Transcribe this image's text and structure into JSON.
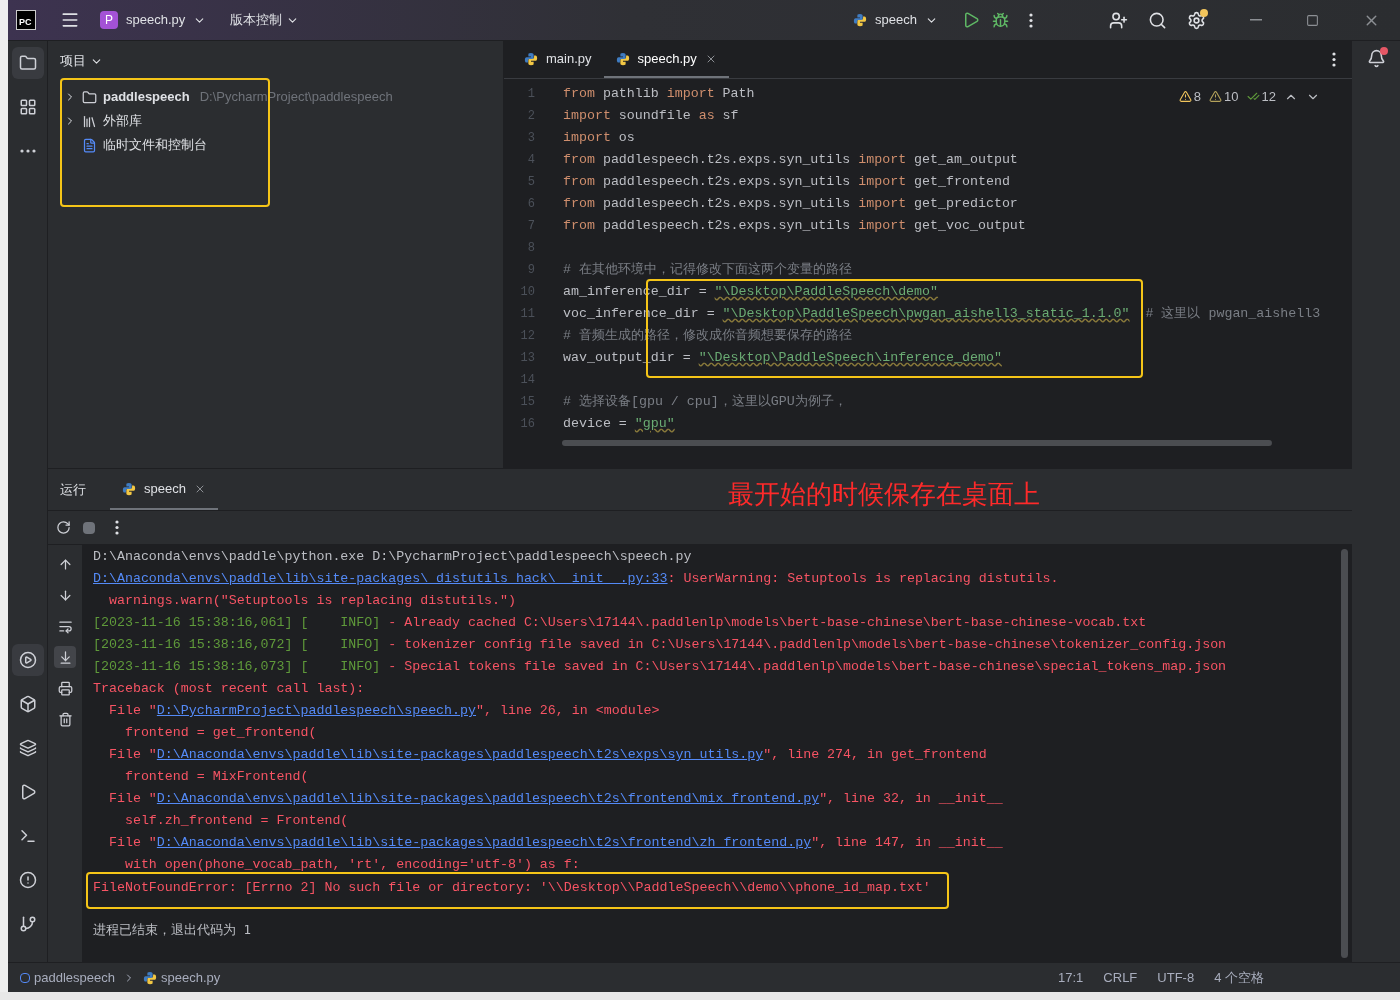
{
  "title_bar": {
    "logo_text": "PC",
    "project_badge": "P",
    "project": "speech.py",
    "vcs": "版本控制",
    "run_config": "speech"
  },
  "project_panel": {
    "title": "项目",
    "items": [
      {
        "kind": "folder",
        "label": "paddlespeech",
        "hint": "D:\\PycharmProject\\paddlespeech",
        "expanded": false
      },
      {
        "kind": "library",
        "label": "外部库",
        "expanded": false
      },
      {
        "kind": "scratch",
        "label": "临时文件和控制台"
      }
    ]
  },
  "editor": {
    "tabs": [
      {
        "label": "main.py",
        "selected": false
      },
      {
        "label": "speech.py",
        "selected": true
      }
    ],
    "inspections": [
      {
        "kind": "warning",
        "count": "8"
      },
      {
        "kind": "weak",
        "count": "10"
      },
      {
        "kind": "typo",
        "count": "12"
      }
    ],
    "lines": [
      {
        "number": "1",
        "segments": [
          {
            "kind": "kw",
            "text": "from"
          },
          {
            "kind": "plain",
            "text": " pathlib "
          },
          {
            "kind": "kw",
            "text": "import"
          },
          {
            "kind": "plain",
            "text": " Path"
          }
        ]
      },
      {
        "number": "2",
        "segments": [
          {
            "kind": "kw",
            "text": "import"
          },
          {
            "kind": "plain",
            "text": " soundfile "
          },
          {
            "kind": "kw",
            "text": "as"
          },
          {
            "kind": "plain",
            "text": " sf"
          }
        ]
      },
      {
        "number": "3",
        "segments": [
          {
            "kind": "kw",
            "text": "import"
          },
          {
            "kind": "plain",
            "text": " os"
          }
        ]
      },
      {
        "number": "4",
        "segments": [
          {
            "kind": "kw",
            "text": "from"
          },
          {
            "kind": "plain",
            "text": " paddlespeech.t2s.exps.syn_utils "
          },
          {
            "kind": "kw",
            "text": "import"
          },
          {
            "kind": "plain",
            "text": " get_am_output"
          }
        ]
      },
      {
        "number": "5",
        "segments": [
          {
            "kind": "kw",
            "text": "from"
          },
          {
            "kind": "plain",
            "text": " paddlespeech.t2s.exps.syn_utils "
          },
          {
            "kind": "kw",
            "text": "import"
          },
          {
            "kind": "plain",
            "text": " get_frontend"
          }
        ]
      },
      {
        "number": "6",
        "segments": [
          {
            "kind": "kw",
            "text": "from"
          },
          {
            "kind": "plain",
            "text": " paddlespeech.t2s.exps.syn_utils "
          },
          {
            "kind": "kw",
            "text": "import"
          },
          {
            "kind": "plain",
            "text": " get_predictor"
          }
        ]
      },
      {
        "number": "7",
        "segments": [
          {
            "kind": "kw",
            "text": "from"
          },
          {
            "kind": "plain",
            "text": " paddlespeech.t2s.exps.syn_utils "
          },
          {
            "kind": "kw",
            "text": "import"
          },
          {
            "kind": "plain",
            "text": " get_voc_output"
          }
        ]
      },
      {
        "number": "8"
      },
      {
        "number": "9",
        "segments": [
          {
            "kind": "comment",
            "text": "# 在其他环境中，记得修改下面这两个变量的路径"
          }
        ]
      },
      {
        "number": "10",
        "segments": [
          {
            "kind": "plain",
            "text": "am_inference_dir = "
          },
          {
            "kind": "str",
            "text": "\"\\Desktop\\PaddleSpeech\\demo\""
          }
        ]
      },
      {
        "number": "11",
        "segments": [
          {
            "kind": "plain",
            "text": "voc_inference_dir = "
          },
          {
            "kind": "str",
            "text": "\"\\Desktop\\PaddleSpeech\\pwgan_aishell3_static_1.1.0\""
          },
          {
            "kind": "comment",
            "text": "# 这里以 pwgan_aishell3"
          }
        ]
      },
      {
        "number": "12",
        "segments": [
          {
            "kind": "comment",
            "text": "# 音频生成的路径，修改成你音频想要保存的路径"
          }
        ]
      },
      {
        "number": "13",
        "segments": [
          {
            "kind": "plain",
            "text": "wav_output_dir = "
          },
          {
            "kind": "str",
            "text": "\"\\Desktop\\PaddleSpeech\\inference_demo\""
          }
        ]
      },
      {
        "number": "14"
      },
      {
        "number": "15",
        "segments": [
          {
            "kind": "comment",
            "text": "# 选择设备[gpu / cpu]，这里以GPU为例子，"
          }
        ]
      },
      {
        "number": "16",
        "segments": [
          {
            "kind": "plain",
            "text": "device = "
          },
          {
            "kind": "str",
            "text": "\"gpu\""
          }
        ]
      }
    ]
  },
  "run_panel": {
    "title": "运行",
    "tabs": [
      {
        "label": "speech",
        "selected": true
      }
    ],
    "console": [
      {
        "segments": [
          {
            "kind": "cmd",
            "text": "D:\\Anaconda\\envs\\paddle\\python.exe D:\\PycharmProject\\paddlespeech\\speech.py"
          }
        ]
      },
      {
        "segments": [
          {
            "kind": "link",
            "text": "D:\\Anaconda\\envs\\paddle\\lib\\site-packages\\_distutils_hack\\__init__.py:33"
          },
          {
            "kind": "err",
            "text": ": UserWarning: Setuptools is replacing distutils."
          }
        ]
      },
      {
        "segments": [
          {
            "kind": "err",
            "text": "  warnings.warn(\"Setuptools is replacing distutils.\")"
          }
        ]
      },
      {
        "segments": [
          {
            "kind": "info",
            "text": "[2023-11-16 15:38:16,061] [    INFO]"
          },
          {
            "kind": "err",
            "text": " - Already cached C:\\Users\\17144\\.paddlenlp\\models\\bert-base-chinese\\bert-base-chinese-vocab.txt"
          }
        ]
      },
      {
        "segments": [
          {
            "kind": "info",
            "text": "[2023-11-16 15:38:16,072] [    INFO]"
          },
          {
            "kind": "err",
            "text": " - tokenizer config file saved in C:\\Users\\17144\\.paddlenlp\\models\\bert-base-chinese\\tokenizer_config.json"
          }
        ]
      },
      {
        "segments": [
          {
            "kind": "info",
            "text": "[2023-11-16 15:38:16,073] [    INFO]"
          },
          {
            "kind": "err",
            "text": " - Special tokens file saved in C:\\Users\\17144\\.paddlenlp\\models\\bert-base-chinese\\special_tokens_map.json"
          }
        ]
      },
      {
        "segments": [
          {
            "kind": "err",
            "text": "Traceback (most recent call last):"
          }
        ]
      },
      {
        "segments": [
          {
            "kind": "err",
            "text": "  File \""
          },
          {
            "kind": "link",
            "text": "D:\\PycharmProject\\paddlespeech\\speech.py"
          },
          {
            "kind": "err",
            "text": "\", line 26, in <module>"
          }
        ]
      },
      {
        "segments": [
          {
            "kind": "err",
            "text": "    frontend = get_frontend("
          }
        ]
      },
      {
        "segments": [
          {
            "kind": "err",
            "text": "  File \""
          },
          {
            "kind": "link",
            "text": "D:\\Anaconda\\envs\\paddle\\lib\\site-packages\\paddlespeech\\t2s\\exps\\syn_utils.py"
          },
          {
            "kind": "err",
            "text": "\", line 274, in get_frontend"
          }
        ]
      },
      {
        "segments": [
          {
            "kind": "err",
            "text": "    frontend = MixFrontend("
          }
        ]
      },
      {
        "segments": [
          {
            "kind": "err",
            "text": "  File \""
          },
          {
            "kind": "link",
            "text": "D:\\Anaconda\\envs\\paddle\\lib\\site-packages\\paddlespeech\\t2s\\frontend\\mix_frontend.py"
          },
          {
            "kind": "err",
            "text": "\", line 32, in __init__"
          }
        ]
      },
      {
        "segments": [
          {
            "kind": "err",
            "text": "    self.zh_frontend = Frontend("
          }
        ]
      },
      {
        "segments": [
          {
            "kind": "err",
            "text": "  File \""
          },
          {
            "kind": "link",
            "text": "D:\\Anaconda\\envs\\paddle\\lib\\site-packages\\paddlespeech\\t2s\\frontend\\zh_frontend.py"
          },
          {
            "kind": "err",
            "text": "\", line 147, in __init__"
          }
        ]
      },
      {
        "segments": [
          {
            "kind": "err",
            "text": "    with open(phone_vocab_path, 'rt', encoding='utf-8') as f:"
          }
        ]
      },
      {
        "highlighted": true,
        "segments": [
          {
            "kind": "err",
            "text": "FileNotFoundError: [Errno 2] No such file or directory: '\\\\Desktop\\\\PaddleSpeech\\\\demo\\\\phone_id_map.txt'"
          }
        ]
      },
      {
        "segments": [
          {
            "kind": "exit",
            "text": "进程已结束，退出代码为 1"
          }
        ]
      }
    ]
  },
  "annotation": "最开始的时候保存在桌面上",
  "status_bar": {
    "breadcrumbs": [
      {
        "kind": "module",
        "label": "paddlespeech"
      },
      {
        "kind": "python",
        "label": "speech.py"
      }
    ],
    "items": [
      "17:1",
      "CRLF",
      "UTF-8",
      "4 个空格"
    ]
  }
}
